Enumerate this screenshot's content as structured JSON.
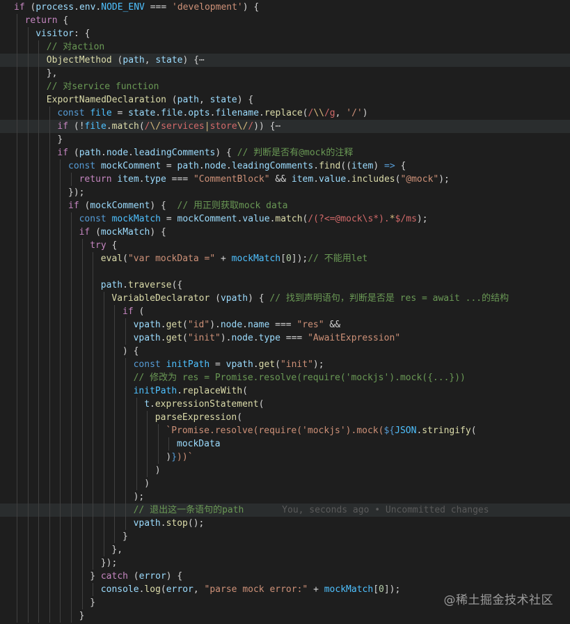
{
  "lines": [
    {
      "t": [
        [
          "ctl",
          "if"
        ],
        [
          "op",
          " ("
        ],
        [
          "var",
          "process"
        ],
        [
          "op",
          "."
        ],
        [
          "var",
          "env"
        ],
        [
          "op",
          "."
        ],
        [
          "cst",
          "NODE_ENV"
        ],
        [
          "op",
          " === "
        ],
        [
          "str",
          "'development'"
        ],
        [
          "op",
          ") {"
        ]
      ],
      "i": 0
    },
    {
      "t": [
        [
          "ctl",
          "return"
        ],
        [
          "op",
          " {"
        ]
      ],
      "i": 1
    },
    {
      "t": [
        [
          "var",
          "visitor"
        ],
        [
          "op",
          ": {"
        ]
      ],
      "i": 2
    },
    {
      "t": [
        [
          "com",
          "// 对action"
        ]
      ],
      "i": 3
    },
    {
      "t": [
        [
          "fn",
          "ObjectMethod"
        ],
        [
          "op",
          " ("
        ],
        [
          "var",
          "path"
        ],
        [
          "op",
          ", "
        ],
        [
          "var",
          "state"
        ],
        [
          "op",
          ") {"
        ],
        [
          "fold",
          "⋯"
        ]
      ],
      "i": 3,
      "hl": true
    },
    {
      "t": [
        [
          "op",
          "},"
        ]
      ],
      "i": 3
    },
    {
      "t": [
        [
          "com",
          "// 对service function"
        ]
      ],
      "i": 3
    },
    {
      "t": [
        [
          "fn",
          "ExportNamedDeclaration"
        ],
        [
          "op",
          " ("
        ],
        [
          "var",
          "path"
        ],
        [
          "op",
          ", "
        ],
        [
          "var",
          "state"
        ],
        [
          "op",
          ") {"
        ]
      ],
      "i": 3
    },
    {
      "t": [
        [
          "kw",
          "const"
        ],
        [
          "op",
          " "
        ],
        [
          "cst",
          "file"
        ],
        [
          "op",
          " = "
        ],
        [
          "var",
          "state"
        ],
        [
          "op",
          "."
        ],
        [
          "var",
          "file"
        ],
        [
          "op",
          "."
        ],
        [
          "var",
          "opts"
        ],
        [
          "op",
          "."
        ],
        [
          "var",
          "filename"
        ],
        [
          "op",
          "."
        ],
        [
          "fn",
          "replace"
        ],
        [
          "op",
          "("
        ],
        [
          "rx",
          "/"
        ],
        [
          "esc",
          "\\\\"
        ],
        [
          "rx",
          "/g"
        ],
        [
          "op",
          ", "
        ],
        [
          "str",
          "'/'"
        ],
        [
          "op",
          ")"
        ]
      ],
      "i": 4
    },
    {
      "t": [
        [
          "ctl",
          "if"
        ],
        [
          "op",
          " (!"
        ],
        [
          "cst",
          "file"
        ],
        [
          "op",
          "."
        ],
        [
          "fn",
          "match"
        ],
        [
          "op",
          "("
        ],
        [
          "rx",
          "/"
        ],
        [
          "esc",
          "\\/"
        ],
        [
          "rx",
          "services"
        ],
        [
          "esc",
          "|"
        ],
        [
          "rx",
          "store"
        ],
        [
          "esc",
          "\\/"
        ],
        [
          "rx",
          "/"
        ],
        [
          "op",
          ")) {"
        ],
        [
          "fold",
          "⋯"
        ]
      ],
      "i": 4,
      "hl": true
    },
    {
      "t": [
        [
          "op",
          "}"
        ]
      ],
      "i": 4
    },
    {
      "t": [
        [
          "ctl",
          "if"
        ],
        [
          "op",
          " ("
        ],
        [
          "var",
          "path"
        ],
        [
          "op",
          "."
        ],
        [
          "var",
          "node"
        ],
        [
          "op",
          "."
        ],
        [
          "var",
          "leadingComments"
        ],
        [
          "op",
          ") { "
        ],
        [
          "com",
          "// 判断是否有@mock的注释"
        ]
      ],
      "i": 4
    },
    {
      "t": [
        [
          "kw",
          "const"
        ],
        [
          "op",
          " "
        ],
        [
          "var",
          "mockComment"
        ],
        [
          "op",
          " = "
        ],
        [
          "var",
          "path"
        ],
        [
          "op",
          "."
        ],
        [
          "var",
          "node"
        ],
        [
          "op",
          "."
        ],
        [
          "var",
          "leadingComments"
        ],
        [
          "op",
          "."
        ],
        [
          "fn",
          "find"
        ],
        [
          "op",
          "(("
        ],
        [
          "var",
          "item"
        ],
        [
          "op",
          ") "
        ],
        [
          "kw",
          "=>"
        ],
        [
          "op",
          " {"
        ]
      ],
      "i": 5
    },
    {
      "t": [
        [
          "ctl",
          "return"
        ],
        [
          "op",
          " "
        ],
        [
          "var",
          "item"
        ],
        [
          "op",
          "."
        ],
        [
          "var",
          "type"
        ],
        [
          "op",
          " === "
        ],
        [
          "str",
          "\"CommentBlock\""
        ],
        [
          "op",
          " && "
        ],
        [
          "var",
          "item"
        ],
        [
          "op",
          "."
        ],
        [
          "var",
          "value"
        ],
        [
          "op",
          "."
        ],
        [
          "fn",
          "includes"
        ],
        [
          "op",
          "("
        ],
        [
          "str",
          "\"@mock\""
        ],
        [
          "op",
          ");"
        ]
      ],
      "i": 6
    },
    {
      "t": [
        [
          "op",
          "});"
        ]
      ],
      "i": 5
    },
    {
      "t": [
        [
          "ctl",
          "if"
        ],
        [
          "op",
          " ("
        ],
        [
          "var",
          "mockComment"
        ],
        [
          "op",
          ") {  "
        ],
        [
          "com",
          "// 用正则获取mock data"
        ]
      ],
      "i": 5
    },
    {
      "t": [
        [
          "kw",
          "const"
        ],
        [
          "op",
          " "
        ],
        [
          "cst",
          "mockMatch"
        ],
        [
          "op",
          " = "
        ],
        [
          "var",
          "mockComment"
        ],
        [
          "op",
          "."
        ],
        [
          "var",
          "value"
        ],
        [
          "op",
          "."
        ],
        [
          "fn",
          "match"
        ],
        [
          "op",
          "("
        ],
        [
          "rx",
          "/(?<=@mock\\s*)."
        ],
        [
          "esc",
          "*"
        ],
        [
          "rx",
          "$/ms"
        ],
        [
          "op",
          ");"
        ]
      ],
      "i": 6
    },
    {
      "t": [
        [
          "ctl",
          "if"
        ],
        [
          "op",
          " ("
        ],
        [
          "var",
          "mockMatch"
        ],
        [
          "op",
          ") {"
        ]
      ],
      "i": 6
    },
    {
      "t": [
        [
          "ctl",
          "try"
        ],
        [
          "op",
          " {"
        ]
      ],
      "i": 7
    },
    {
      "t": [
        [
          "fn",
          "eval"
        ],
        [
          "op",
          "("
        ],
        [
          "str",
          "\"var mockData =\""
        ],
        [
          "op",
          " + "
        ],
        [
          "cst",
          "mockMatch"
        ],
        [
          "op",
          "["
        ],
        [
          "num",
          "0"
        ],
        [
          "op",
          "]);"
        ],
        [
          "com",
          "// 不能用let"
        ]
      ],
      "i": 8
    },
    {
      "t": [],
      "i": 8
    },
    {
      "t": [
        [
          "var",
          "path"
        ],
        [
          "op",
          "."
        ],
        [
          "fn",
          "traverse"
        ],
        [
          "op",
          "({"
        ]
      ],
      "i": 8
    },
    {
      "t": [
        [
          "fn",
          "VariableDeclarator"
        ],
        [
          "op",
          " ("
        ],
        [
          "var",
          "vpath"
        ],
        [
          "op",
          ") { "
        ],
        [
          "com",
          "// 找到声明语句，判断是否是 res = await ...的结构"
        ]
      ],
      "i": 9
    },
    {
      "t": [
        [
          "ctl",
          "if"
        ],
        [
          "op",
          " ("
        ]
      ],
      "i": 10
    },
    {
      "t": [
        [
          "var",
          "vpath"
        ],
        [
          "op",
          "."
        ],
        [
          "fn",
          "get"
        ],
        [
          "op",
          "("
        ],
        [
          "str",
          "\"id\""
        ],
        [
          "op",
          ")."
        ],
        [
          "var",
          "node"
        ],
        [
          "op",
          "."
        ],
        [
          "var",
          "name"
        ],
        [
          "op",
          " === "
        ],
        [
          "str",
          "\"res\""
        ],
        [
          "op",
          " &&"
        ]
      ],
      "i": 11
    },
    {
      "t": [
        [
          "var",
          "vpath"
        ],
        [
          "op",
          "."
        ],
        [
          "fn",
          "get"
        ],
        [
          "op",
          "("
        ],
        [
          "str",
          "\"init\""
        ],
        [
          "op",
          ")."
        ],
        [
          "var",
          "node"
        ],
        [
          "op",
          "."
        ],
        [
          "var",
          "type"
        ],
        [
          "op",
          " === "
        ],
        [
          "str",
          "\"AwaitExpression\""
        ]
      ],
      "i": 11
    },
    {
      "t": [
        [
          "op",
          ") "
        ],
        [
          "op",
          "{"
        ]
      ],
      "i": 10
    },
    {
      "t": [
        [
          "kw",
          "const"
        ],
        [
          "op",
          " "
        ],
        [
          "cst",
          "initPath"
        ],
        [
          "op",
          " = "
        ],
        [
          "var",
          "vpath"
        ],
        [
          "op",
          "."
        ],
        [
          "fn",
          "get"
        ],
        [
          "op",
          "("
        ],
        [
          "str",
          "\"init\""
        ],
        [
          "op",
          ");"
        ]
      ],
      "i": 11
    },
    {
      "t": [
        [
          "com",
          "// 修改为 res = Promise.resolve(require('mockjs').mock({...}))"
        ]
      ],
      "i": 11
    },
    {
      "t": [
        [
          "cst",
          "initPath"
        ],
        [
          "op",
          "."
        ],
        [
          "fn",
          "replaceWith"
        ],
        [
          "op",
          "("
        ]
      ],
      "i": 11
    },
    {
      "t": [
        [
          "var",
          "t"
        ],
        [
          "op",
          "."
        ],
        [
          "fn",
          "expressionStatement"
        ],
        [
          "op",
          "("
        ]
      ],
      "i": 12
    },
    {
      "t": [
        [
          "fn",
          "parseExpression"
        ],
        [
          "op",
          "("
        ]
      ],
      "i": 13
    },
    {
      "t": [
        [
          "tmpl",
          "`Promise.resolve(require('mockjs').mock("
        ],
        [
          "kw",
          "${"
        ],
        [
          "cst",
          "JSON"
        ],
        [
          "op",
          "."
        ],
        [
          "fn",
          "stringify"
        ],
        [
          "op",
          "("
        ]
      ],
      "i": 14
    },
    {
      "t": [
        [
          "var",
          "mockData"
        ]
      ],
      "i": 15
    },
    {
      "t": [
        [
          "op",
          ")"
        ],
        [
          "kw",
          "}"
        ],
        [
          "tmpl",
          "))`"
        ]
      ],
      "i": 14
    },
    {
      "t": [
        [
          "op",
          ")"
        ]
      ],
      "i": 13
    },
    {
      "t": [
        [
          "op",
          ")"
        ]
      ],
      "i": 12
    },
    {
      "t": [
        [
          "op",
          ");"
        ]
      ],
      "i": 11
    },
    {
      "t": [
        [
          "com",
          "// 退出这一条语句的path"
        ],
        [
          "blame",
          "       You, seconds ago • Uncommitted changes"
        ]
      ],
      "i": 11,
      "hl": true
    },
    {
      "t": [
        [
          "var",
          "vpath"
        ],
        [
          "op",
          "."
        ],
        [
          "fn",
          "stop"
        ],
        [
          "op",
          "();"
        ]
      ],
      "i": 11
    },
    {
      "t": [
        [
          "op",
          "}"
        ]
      ],
      "i": 10
    },
    {
      "t": [
        [
          "op",
          "},"
        ]
      ],
      "i": 9
    },
    {
      "t": [
        [
          "op",
          "});"
        ]
      ],
      "i": 8
    },
    {
      "t": [
        [
          "op",
          "} "
        ],
        [
          "ctl",
          "catch"
        ],
        [
          "op",
          " ("
        ],
        [
          "var",
          "error"
        ],
        [
          "op",
          ") {"
        ]
      ],
      "i": 7
    },
    {
      "t": [
        [
          "var",
          "console"
        ],
        [
          "op",
          "."
        ],
        [
          "fn",
          "log"
        ],
        [
          "op",
          "("
        ],
        [
          "var",
          "error"
        ],
        [
          "op",
          ", "
        ],
        [
          "str",
          "\"parse mock error:\""
        ],
        [
          "op",
          " + "
        ],
        [
          "cst",
          "mockMatch"
        ],
        [
          "op",
          "["
        ],
        [
          "num",
          "0"
        ],
        [
          "op",
          "]);"
        ]
      ],
      "i": 8
    },
    {
      "t": [
        [
          "op",
          "}"
        ]
      ],
      "i": 7
    },
    {
      "t": [
        [
          "op",
          "}"
        ]
      ],
      "i": 6
    }
  ],
  "watermark": "@稀土掘金技术社区",
  "colors": {
    "background": "#1e1e1e",
    "line_highlight": "#2a2d2e"
  }
}
